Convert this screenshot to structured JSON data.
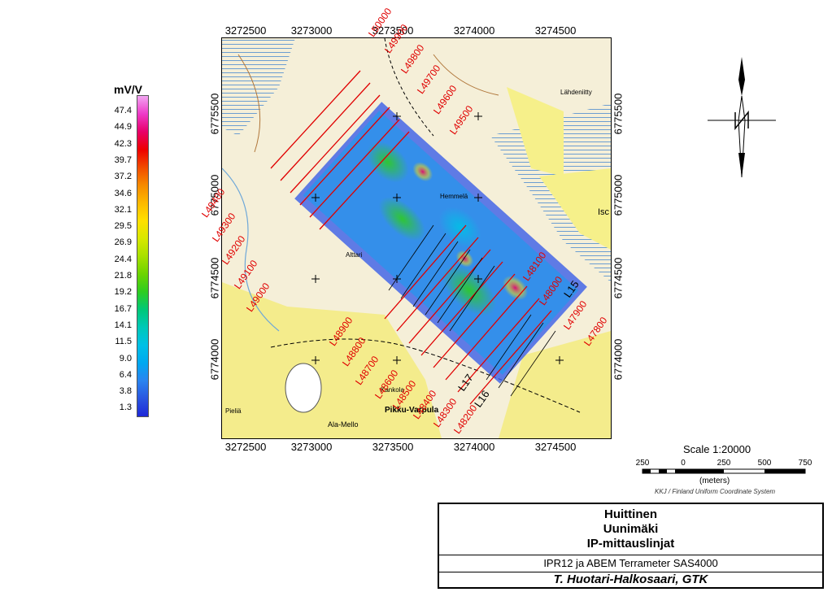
{
  "legend": {
    "unit": "mV/V",
    "values": [
      "47.4",
      "44.9",
      "42.3",
      "39.7",
      "37.2",
      "34.6",
      "32.1",
      "29.5",
      "26.9",
      "24.4",
      "21.8",
      "19.2",
      "16.7",
      "14.1",
      "11.5",
      "9.0",
      "6.4",
      "3.8",
      "1.3"
    ],
    "colors": [
      "#f2a6f2",
      "#ee3ac8",
      "#e8006a",
      "#ee0000",
      "#f14a00",
      "#f68a00",
      "#fcb800",
      "#ffe000",
      "#d9e800",
      "#a8e000",
      "#6cd400",
      "#2ecc20",
      "#00c878",
      "#00c8b8",
      "#00c0e6",
      "#00a8f0",
      "#2a84f0",
      "#2a56e0",
      "#1e28d8"
    ]
  },
  "axes": {
    "top": [
      "3272500",
      "3273000",
      "3273500",
      "3274000",
      "3274500"
    ],
    "bottom": [
      "3272500",
      "3273000",
      "3273500",
      "3274000",
      "3274500"
    ],
    "left": [
      "6775500",
      "6775000",
      "6774500",
      "6774000"
    ],
    "right": [
      "6775500",
      "6775000",
      "6774500",
      "6774000"
    ]
  },
  "map": {
    "place_labels": [
      "Pikku-Varpula",
      "Ala-Mello",
      "Pieliä",
      "Kankola",
      "Lähdeniitty",
      "Isc",
      "Hemmelä",
      "Alttari"
    ],
    "line_labels": [
      "L50000",
      "L49900",
      "L49800",
      "L49700",
      "L49600",
      "L49500",
      "L49400",
      "L49300",
      "L49200",
      "L49100",
      "L49000",
      "L48900",
      "L48800",
      "L48700",
      "L48600",
      "L48500",
      "L48400",
      "L48300",
      "L48200",
      "L48100",
      "L48000",
      "L47900",
      "L47800",
      "L17",
      "L16",
      "L15"
    ]
  },
  "scale": {
    "title": "Scale 1:20000",
    "ticks": [
      "250",
      "0",
      "250",
      "500",
      "750"
    ],
    "units": "(meters)",
    "crs": "KKJ / Finland Uniform Coordinate System"
  },
  "title_block": {
    "line1": "Huittinen",
    "line2": "Uunimäki",
    "line3": "IP-mittauslinjat",
    "subtitle": "IPR12 ja ABEM Terrameter SAS4000",
    "author": "T. Huotari-Halkosaari, GTK"
  }
}
